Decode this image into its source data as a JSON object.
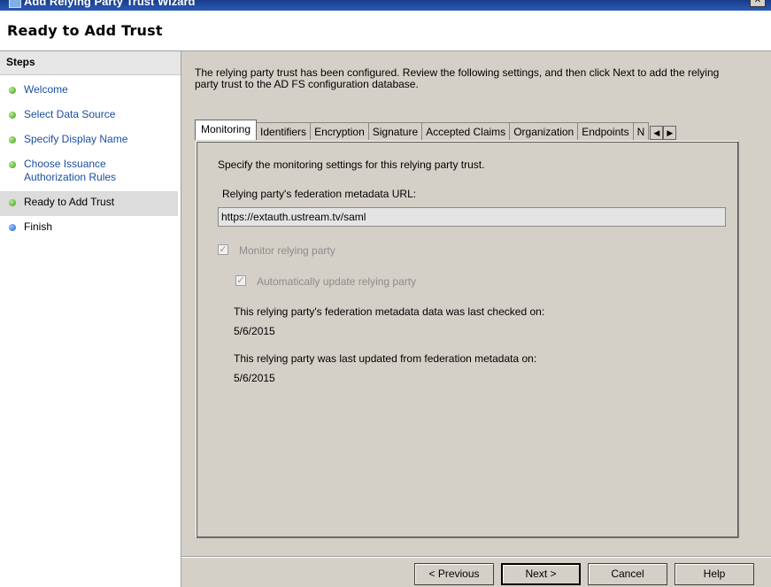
{
  "window": {
    "title": "Add Relying Party Trust Wizard",
    "close_glyph": "✕"
  },
  "header": {
    "title": "Ready to Add Trust"
  },
  "sidebar": {
    "heading": "Steps",
    "items": [
      {
        "label": "Welcome",
        "status": "done"
      },
      {
        "label": "Select Data Source",
        "status": "done"
      },
      {
        "label": "Specify Display Name",
        "status": "done"
      },
      {
        "label": "Choose Issuance Authorization Rules",
        "status": "done"
      },
      {
        "label": "Ready to Add Trust",
        "status": "current"
      },
      {
        "label": "Finish",
        "status": "pending"
      }
    ]
  },
  "intro": "The relying party trust has been configured. Review the following settings, and then click Next to add the relying party trust to the AD FS configuration database.",
  "tabs": [
    {
      "label": "Monitoring",
      "active": true
    },
    {
      "label": "Identifiers"
    },
    {
      "label": "Encryption"
    },
    {
      "label": "Signature"
    },
    {
      "label": "Accepted Claims"
    },
    {
      "label": "Organization"
    },
    {
      "label": "Endpoints"
    },
    {
      "label": "N"
    }
  ],
  "tab_scroll": {
    "left": "◀",
    "right": "▶"
  },
  "monitoring": {
    "description": "Specify the monitoring settings for this relying party trust.",
    "url_label": "Relying party's federation metadata URL:",
    "url_value": "https://extauth.ustream.tv/saml",
    "monitor_label": "Monitor relying party",
    "monitor_checked": true,
    "auto_update_label": "Automatically update relying party",
    "auto_update_checked": true,
    "last_checked_label": "This relying party's federation metadata data was last checked on:",
    "last_checked_value": "5/6/2015",
    "last_updated_label": "This relying party was last updated from federation metadata on:",
    "last_updated_value": "5/6/2015",
    "check_glyph": "✓"
  },
  "buttons": {
    "previous": "< Previous",
    "next": "Next >",
    "cancel": "Cancel",
    "help": "Help"
  },
  "colors": {
    "step_link": "#1a4fa3",
    "done_dot": "#3a9a1a",
    "pending_dot": "#1c5bd6",
    "window_bg": "#d4d0c8"
  }
}
